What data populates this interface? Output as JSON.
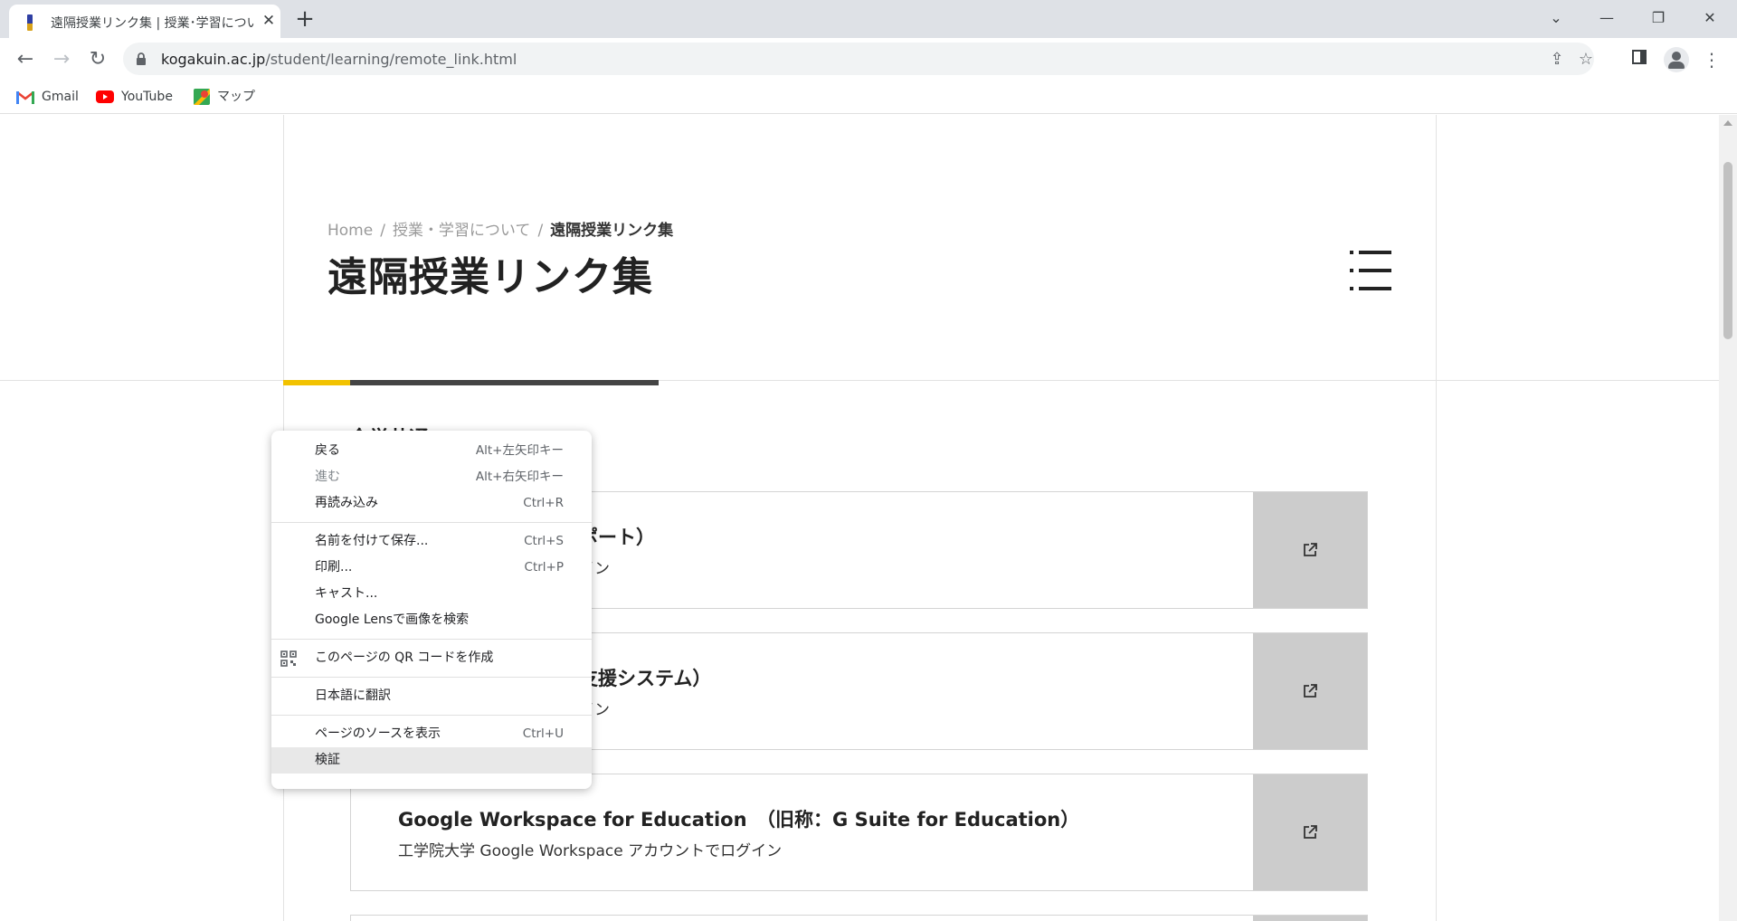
{
  "browser": {
    "tab_title": "遠隔授業リンク集 | 授業･学習につい",
    "url_domain": "kogakuin.ac.jp",
    "url_path": "/student/learning/remote_link.html",
    "bookmarks": [
      {
        "label": "Gmail",
        "icon": "gmail-icon"
      },
      {
        "label": "YouTube",
        "icon": "youtube-icon"
      },
      {
        "label": "マップ",
        "icon": "maps-icon"
      }
    ]
  },
  "page": {
    "breadcrumb": {
      "home": "Home",
      "parent": "授業・学習について",
      "current": "遠隔授業リンク集",
      "separator": "/"
    },
    "title": "遠隔授業リンク集",
    "section_heading": "全学共通",
    "cards": [
      {
        "title": "ポート）",
        "subtitle": "イン"
      },
      {
        "title": "支援システム）",
        "subtitle": "イン"
      },
      {
        "title": "Google Workspace for Education　（旧称：G Suite for Education）",
        "subtitle": "工学院大学 Google Workspace アカウントでログイン"
      }
    ],
    "accent_colors": {
      "yellow": "#f2c200",
      "dark": "#444444",
      "link_box": "#cccccc"
    }
  },
  "context_menu": {
    "groups": [
      [
        {
          "label": "戻る",
          "shortcut": "Alt+左矢印キー"
        },
        {
          "label": "進む",
          "shortcut": "Alt+右矢印キー",
          "disabled": true
        },
        {
          "label": "再読み込み",
          "shortcut": "Ctrl+R"
        }
      ],
      [
        {
          "label": "名前を付けて保存...",
          "shortcut": "Ctrl+S"
        },
        {
          "label": "印刷...",
          "shortcut": "Ctrl+P"
        },
        {
          "label": "キャスト..."
        },
        {
          "label": "Google Lensで画像を検索"
        }
      ],
      [
        {
          "label": "このページの QR コードを作成",
          "icon": "qr-code-icon"
        }
      ],
      [
        {
          "label": "日本語に翻訳"
        }
      ],
      [
        {
          "label": "ページのソースを表示",
          "shortcut": "Ctrl+U"
        },
        {
          "label": "検証",
          "hovered": true
        }
      ]
    ]
  }
}
